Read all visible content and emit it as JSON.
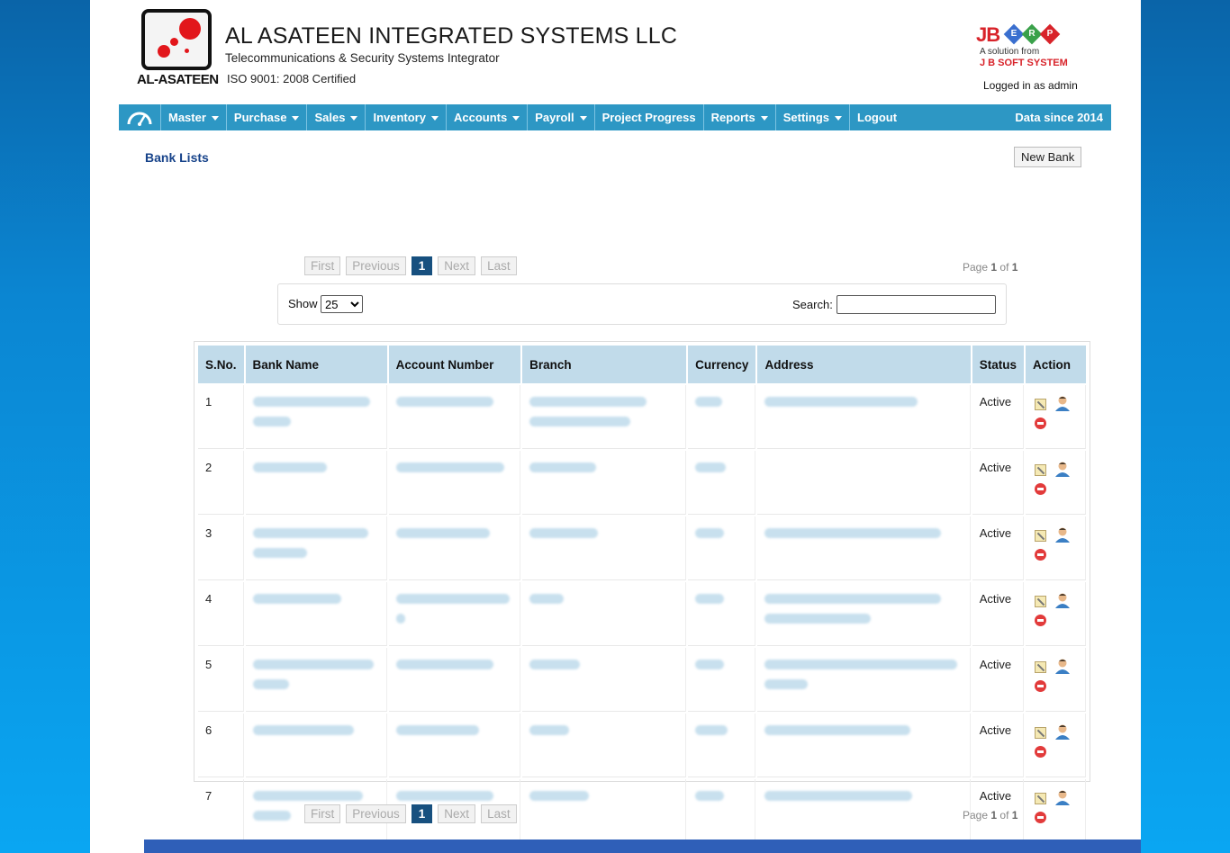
{
  "header": {
    "logo_text": "AL-ASATEEN",
    "company_name": "AL ASATEEN INTEGRATED SYSTEMS LLC",
    "tagline": "Telecommunications & Security Systems Integrator",
    "certification": "ISO 9001: 2008 Certified",
    "erp_brand": {
      "jb": "JB",
      "letters": [
        "E",
        "R",
        "P"
      ],
      "line1": "A solution from",
      "line2": "J B SOFT SYSTEM"
    },
    "logged_in": "Logged in as admin"
  },
  "nav": {
    "items": [
      {
        "label": "Master",
        "dropdown": true
      },
      {
        "label": "Purchase",
        "dropdown": true
      },
      {
        "label": "Sales",
        "dropdown": true
      },
      {
        "label": "Inventory",
        "dropdown": true
      },
      {
        "label": "Accounts",
        "dropdown": true
      },
      {
        "label": "Payroll",
        "dropdown": true
      },
      {
        "label": "Project Progress",
        "dropdown": false
      },
      {
        "label": "Reports",
        "dropdown": true
      },
      {
        "label": "Settings",
        "dropdown": true
      },
      {
        "label": "Logout",
        "dropdown": false
      }
    ],
    "data_since": "Data since 2014"
  },
  "page": {
    "title": "Bank Lists",
    "new_button": "New Bank"
  },
  "pager": {
    "first": "First",
    "previous": "Previous",
    "current": "1",
    "next": "Next",
    "last": "Last",
    "info_prefix": "Page",
    "page": "1",
    "of": "of",
    "total": "1"
  },
  "filter": {
    "show_label": "Show",
    "show_value": "25",
    "search_label": "Search:"
  },
  "table": {
    "columns": [
      "S.No.",
      "Bank Name",
      "Account Number",
      "Branch",
      "Currency",
      "Address",
      "Status",
      "Action"
    ],
    "rows": [
      {
        "sno": "1",
        "status": "Active"
      },
      {
        "sno": "2",
        "status": "Active"
      },
      {
        "sno": "3",
        "status": "Active"
      },
      {
        "sno": "4",
        "status": "Active"
      },
      {
        "sno": "5",
        "status": "Active"
      },
      {
        "sno": "6",
        "status": "Active"
      },
      {
        "sno": "7",
        "status": "Active"
      }
    ]
  },
  "icons": [
    "dashboard-icon",
    "edit-icon",
    "user-icon",
    "delete-icon",
    "caret-down-icon"
  ],
  "colors": {
    "nav_bg": "#2d97c4",
    "title": "#17438a",
    "pager_active": "#17507f",
    "header_row": "#c1dbea"
  }
}
